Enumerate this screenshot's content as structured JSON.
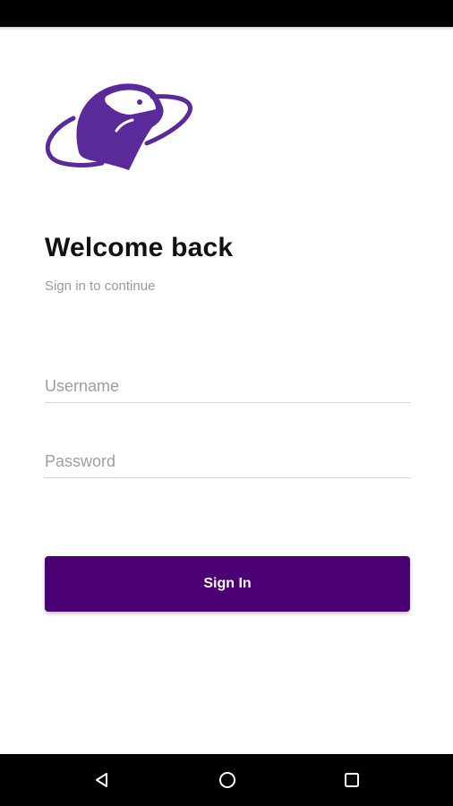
{
  "login": {
    "title": "Welcome back",
    "subtitle": "Sign in to continue",
    "username_placeholder": "Username",
    "password_placeholder": "Password",
    "sign_in_label": "Sign In"
  },
  "colors": {
    "brand": "#5b2a9a",
    "button": "#4a0072",
    "placeholder": "#9e9e9e",
    "subtitle": "#9a9a9a"
  },
  "icons": {
    "logo": "otter-orbit-logo",
    "nav_back": "back-triangle-icon",
    "nav_home": "home-circle-icon",
    "nav_recents": "recents-square-icon"
  }
}
